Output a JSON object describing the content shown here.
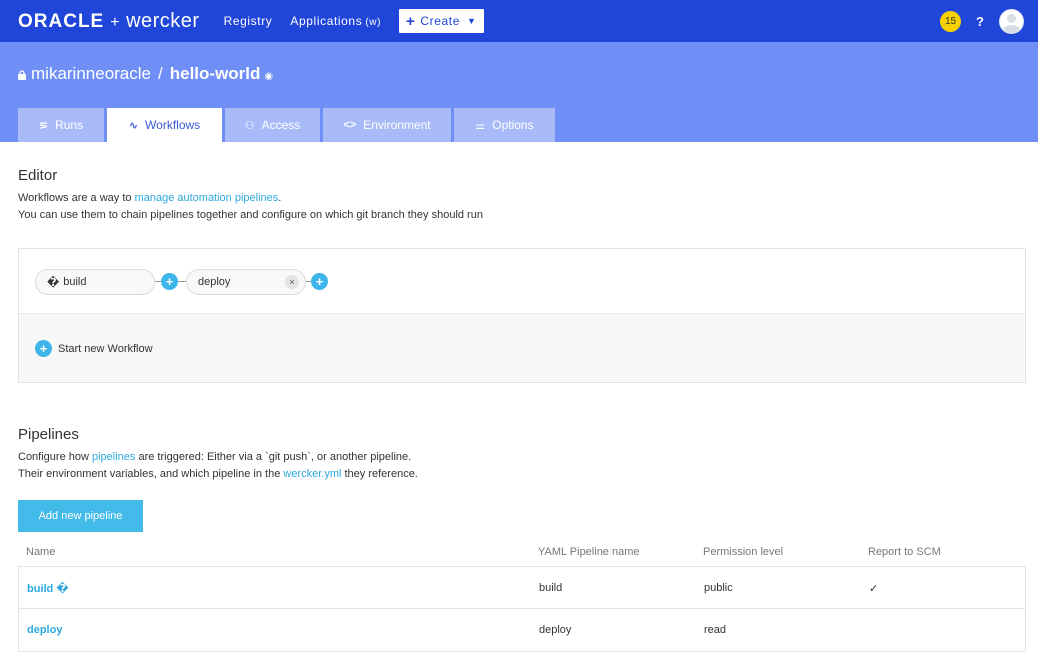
{
  "topbar": {
    "logo_oracle": "ORACLE",
    "logo_plus": "+",
    "logo_wercker": "wercker",
    "nav": [
      {
        "label": "Registry"
      },
      {
        "label": "Applications",
        "hint": "(w)"
      }
    ],
    "create_label": "Create",
    "notification_count": "15",
    "help_label": "?"
  },
  "header": {
    "owner": "mikarinneoracle",
    "separator": "/",
    "repo": "hello-world",
    "eye_glyph": "◉",
    "tabs": [
      {
        "label": "Runs",
        "icon": "runs-icon",
        "glyph": "⋝"
      },
      {
        "label": "Workflows",
        "icon": "workflows-icon",
        "glyph": "∿"
      },
      {
        "label": "Access",
        "icon": "access-icon",
        "glyph": "⚇"
      },
      {
        "label": "Environment",
        "icon": "code-icon",
        "glyph": "<>"
      },
      {
        "label": "Options",
        "icon": "sliders-icon",
        "glyph": "⚌"
      }
    ]
  },
  "editor": {
    "title": "Editor",
    "desc_line1_prefix": "Workflows are a way to ",
    "desc_line1_link": "manage automation pipelines",
    "desc_line1_suffix": ".",
    "desc_line2": "You can use them to chain pipelines together and configure on which git branch they should run",
    "pipeline_build_glyph": "�",
    "pipeline_build": "build",
    "pipeline_deploy": "deploy",
    "remove_glyph": "×",
    "add_glyph": "+",
    "start_new_label": "Start new Workflow"
  },
  "pipelines": {
    "title": "Pipelines",
    "desc_line1_prefix": "Configure how ",
    "desc_line1_link": "pipelines",
    "desc_line1_suffix": " are triggered: Either via a `git push`, or another pipeline.",
    "desc_line2_prefix": "Their environment variables, and which pipeline in the ",
    "desc_line2_link": "wercker.yml",
    "desc_line2_suffix": " they reference.",
    "add_button": "Add new pipeline",
    "columns": [
      "Name",
      "YAML Pipeline name",
      "Permission level",
      "Report to SCM"
    ],
    "rows": [
      {
        "name": "build �",
        "yaml": "build",
        "permission": "public",
        "scm": "✓"
      },
      {
        "name": "deploy",
        "yaml": "deploy",
        "permission": "read",
        "scm": ""
      }
    ]
  },
  "colors": {
    "topbar": "#1f46d8",
    "header": "#6f8ef6",
    "tab_inactive": "#a8bbf8",
    "link": "#2ea8dc",
    "accent_button": "#42bbea",
    "badge": "#f7d200"
  }
}
